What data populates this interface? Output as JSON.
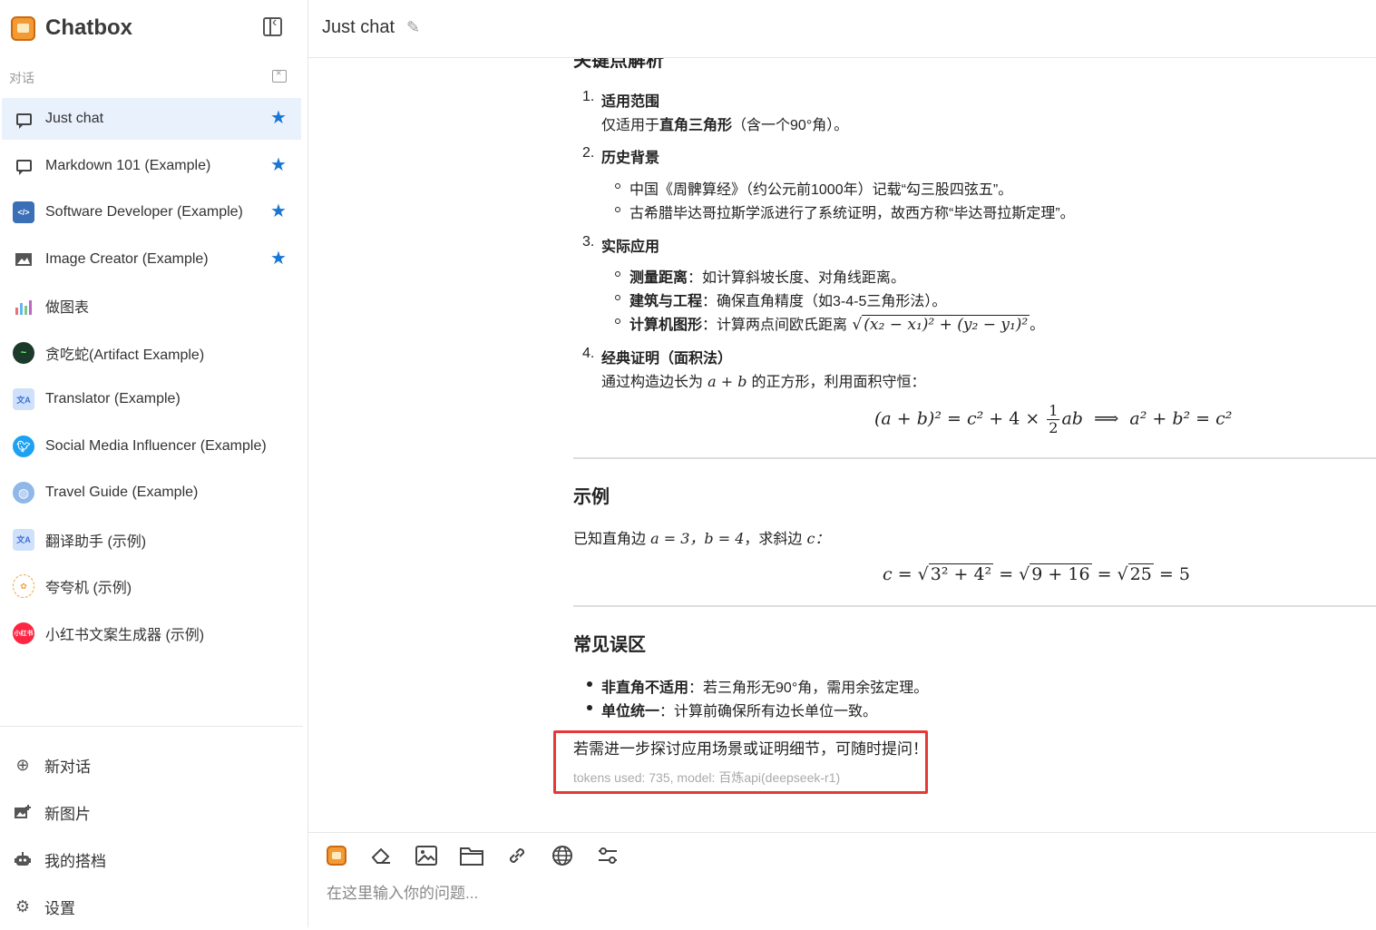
{
  "app": {
    "name": "Chatbox"
  },
  "sidebar": {
    "section_label": "对话",
    "conversations": [
      {
        "label": "Just chat",
        "starred": true,
        "active": true,
        "icon": "chat-bubble-icon"
      },
      {
        "label": "Markdown 101 (Example)",
        "starred": true,
        "icon": "chat-bubble-icon"
      },
      {
        "label": "Software Developer (Example)",
        "starred": true,
        "icon": "developer-avatar-icon"
      },
      {
        "label": "Image Creator (Example)",
        "starred": true,
        "icon": "image-icon"
      },
      {
        "label": "做图表",
        "starred": false,
        "icon": "chart-avatar-icon"
      },
      {
        "label": "贪吃蛇(Artifact Example)",
        "starred": false,
        "icon": "snake-game-avatar-icon"
      },
      {
        "label": "Translator (Example)",
        "starred": false,
        "icon": "translate-avatar-icon"
      },
      {
        "label": "Social Media Influencer (Example)",
        "starred": false,
        "icon": "twitter-avatar-icon"
      },
      {
        "label": "Travel Guide (Example)",
        "starred": false,
        "icon": "globe-avatar-icon"
      },
      {
        "label": "翻译助手 (示例)",
        "starred": false,
        "icon": "translate-avatar-icon"
      },
      {
        "label": "夸夸机 (示例)",
        "starred": false,
        "icon": "praise-avatar-icon"
      },
      {
        "label": "小红书文案生成器 (示例)",
        "starred": false,
        "icon": "xiaohongshu-avatar-icon",
        "avatar_text": "小红书"
      }
    ],
    "bottom_nav": [
      {
        "label": "新对话",
        "icon": "plus-circle-icon"
      },
      {
        "label": "新图片",
        "icon": "new-image-icon"
      },
      {
        "label": "我的搭档",
        "icon": "robot-icon"
      },
      {
        "label": "设置",
        "icon": "gear-icon"
      }
    ]
  },
  "header": {
    "title": "Just chat"
  },
  "message": {
    "cut_heading": "关键点解析",
    "points": [
      {
        "num": "1.",
        "title": "适用范围",
        "desc_pre": "仅适用于",
        "desc_bold": "直角三角形",
        "desc_post": "（含一个90°角）。"
      },
      {
        "num": "2.",
        "title": "历史背景",
        "bullets": [
          "中国《周髀算经》（约公元前1000年）记载“勾三股四弦五”。",
          "古希腊毕达哥拉斯学派进行了系统证明，故西方称“毕达哥拉斯定理”。"
        ]
      },
      {
        "num": "3.",
        "title": "实际应用",
        "bullets": [
          {
            "bold": "测量距离",
            "text": "：如计算斜坡长度、对角线距离。"
          },
          {
            "bold": "建筑与工程",
            "text": "：确保直角精度（如3-4-5三角形法）。"
          },
          {
            "bold": "计算机图形",
            "text": "：计算两点间欧氏距离"
          }
        ]
      },
      {
        "num": "4.",
        "title": "经典证明（面积法）",
        "desc_pre": "通过构造边长为",
        "desc_post": "的正方形，利用面积守恒："
      }
    ],
    "example_heading": "示例",
    "example_text_pre": "已知直角边",
    "example_text_mid": "，求斜边",
    "pitfalls_heading": "常见误区",
    "pitfalls": [
      {
        "bold": "非直角不适用",
        "text": "：若三角形无90°角，需用余弦定理。"
      },
      {
        "bold": "单位统一",
        "text": "：计算前确保所有边长单位一致。"
      }
    ],
    "closing": "若需进一步探讨应用场景或证明细节，可随时提问！",
    "meta": "tokens used: 735, model: 百炼api(deepseek-r1)"
  },
  "input": {
    "placeholder": "在这里输入你的问题..."
  },
  "colors": {
    "accent": "#1976d2",
    "highlight_border": "#e53935",
    "active_bg": "#e9f1fd"
  }
}
